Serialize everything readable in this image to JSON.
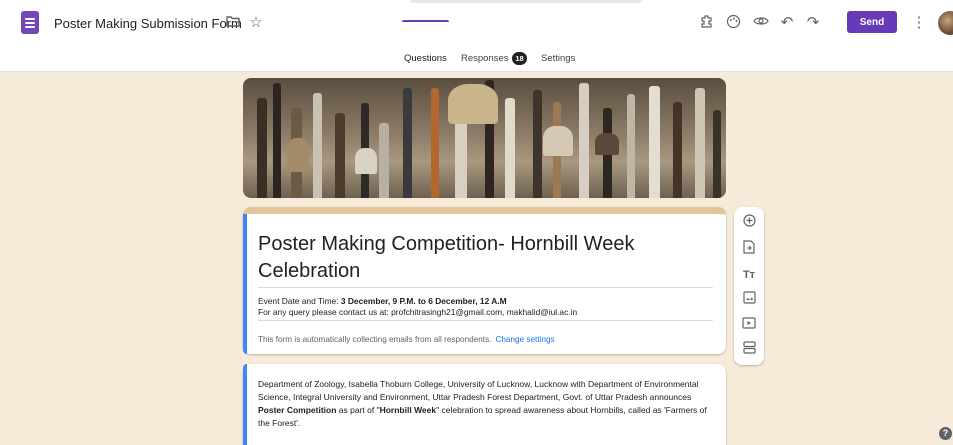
{
  "header": {
    "doc_title": "Poster Making Submission Form",
    "send_label": "Send",
    "icons": [
      "forms-app-icon",
      "folder-icon",
      "star-icon",
      "palette-addon-icon",
      "customize-theme-icon",
      "preview-icon",
      "undo-icon",
      "redo-icon",
      "more-vert-icon"
    ]
  },
  "tabs": {
    "questions": "Questions",
    "responses": "Responses",
    "responses_count": "18",
    "settings": "Settings"
  },
  "form": {
    "title": "Poster Making Competition- Hornbill Week Celebration",
    "date_prefix": "Event Date and Time: ",
    "date_value": "3 December, 9 P.M. to 6 December, 12 A.M",
    "contact": "For any query please contact us at: profchitrasingh21@gmail.com, makhalid@iul.ac.in",
    "collecting_notice": "This form is automatically collecting emails from all respondents.",
    "change_settings": "Change settings"
  },
  "info": {
    "part1": "Department of Zoology, Isabella Thoburn College, University of Lucknow, Lucknow with Department of Environmental Science, Integral University and Environment, Uttar Pradesh Forest Department, Govt. of Uttar Pradesh announces ",
    "bold1": "Poster Competition",
    "part2": " as part of \"",
    "bold2": "Hornbill Week",
    "part3": "\"  celebration to spread awareness about Hornbills, called as 'Farmers of the Forest'."
  },
  "side_toolbar": [
    "add-question-icon",
    "import-questions-icon",
    "add-title-icon",
    "add-image-icon",
    "add-video-icon",
    "add-section-icon"
  ],
  "colors": {
    "accent": "#673ab7",
    "background": "#f6ead9",
    "header_border": "#e1c699",
    "active_bar": "#4285f4",
    "link": "#1a73e8"
  }
}
